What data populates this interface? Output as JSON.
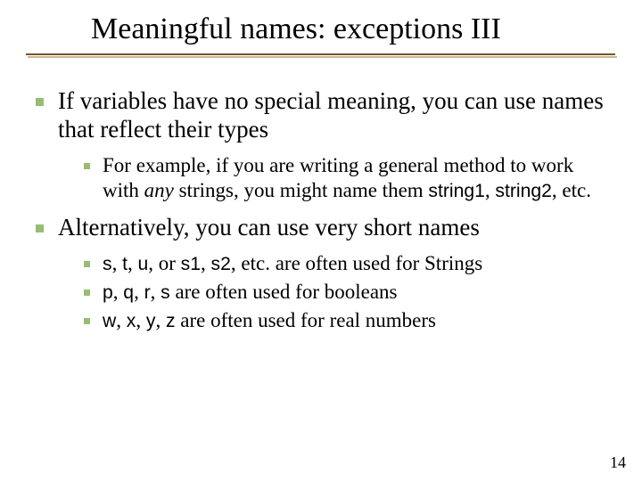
{
  "title": "Meaningful names: exceptions III",
  "bullets": {
    "b1": "If variables have no special meaning, you can use names that reflect their types",
    "b1_sub1_pre": "For example, if you are writing a general method to work with ",
    "b1_sub1_ital": "any",
    "b1_sub1_mid": " strings, you might name them ",
    "b1_sub1_code1": "string1",
    "b1_sub1_sep": ", ",
    "b1_sub1_code2": "string2",
    "b1_sub1_post": ", etc.",
    "b2": "Alternatively, you can use very short names",
    "b2_sub1_c1": "s",
    "b2_sub1_s1": ", ",
    "b2_sub1_c2": "t",
    "b2_sub1_s2": ", ",
    "b2_sub1_c3": "u",
    "b2_sub1_s3": ", or ",
    "b2_sub1_c4": "s1",
    "b2_sub1_s4": ", ",
    "b2_sub1_c5": "s2",
    "b2_sub1_post": ", etc. are often used for Strings",
    "b2_sub2_c1": "p",
    "b2_sub2_s1": ", ",
    "b2_sub2_c2": "q",
    "b2_sub2_s2": ", ",
    "b2_sub2_c3": "r",
    "b2_sub2_s3": ", ",
    "b2_sub2_c4": "s",
    "b2_sub2_post": " are often used for booleans",
    "b2_sub3_c1": "w",
    "b2_sub3_s1": ", ",
    "b2_sub3_c2": "x",
    "b2_sub3_s2": ", ",
    "b2_sub3_c3": "y",
    "b2_sub3_s3": ", ",
    "b2_sub3_c4": "z",
    "b2_sub3_post": " are often used for real numbers"
  },
  "page_number": "14"
}
